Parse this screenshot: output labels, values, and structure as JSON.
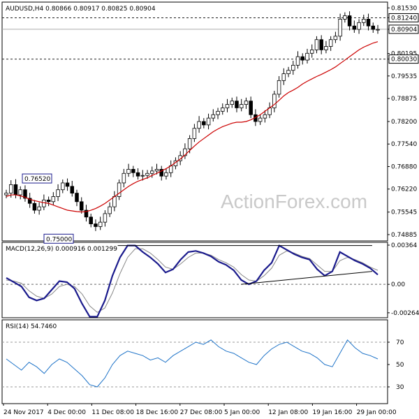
{
  "window": {
    "watermark": "ActionForex.com"
  },
  "chart_data": [
    {
      "type": "candlestick",
      "title": "AUDUSD,H4  0.80866 0.80917 0.80825 0.80904",
      "ylim": [
        0.747,
        0.817
      ],
      "yticks": [
        0.8153,
        0.8124,
        0.80904,
        0.80195,
        0.8003,
        0.79535,
        0.78875,
        0.782,
        0.7754,
        0.7688,
        0.7622,
        0.75545,
        0.74885
      ],
      "y_highlight_labels": [
        0.8124,
        0.80904,
        0.8003
      ],
      "annotations": [
        {
          "text": "0.76520",
          "value": 0.7652
        },
        {
          "text": "0.75000",
          "value": 0.75
        }
      ],
      "horizontal_lines": [
        {
          "value": 0.8124,
          "style": "dashed"
        },
        {
          "value": 0.80904,
          "style": "solid"
        },
        {
          "value": 0.8003,
          "style": "dashed"
        }
      ],
      "close_series": [
        0.761,
        0.7635,
        0.7605,
        0.762,
        0.7595,
        0.758,
        0.756,
        0.757,
        0.759,
        0.7585,
        0.76,
        0.762,
        0.764,
        0.763,
        0.761,
        0.7585,
        0.756,
        0.754,
        0.752,
        0.7512,
        0.7525,
        0.755,
        0.757,
        0.76,
        0.764,
        0.7668,
        0.768,
        0.767,
        0.766,
        0.7662,
        0.7668,
        0.7675,
        0.768,
        0.766,
        0.767,
        0.769,
        0.7705,
        0.772,
        0.774,
        0.777,
        0.78,
        0.782,
        0.781,
        0.783,
        0.784,
        0.785,
        0.786,
        0.787,
        0.788,
        0.786,
        0.787,
        0.788,
        0.784,
        0.782,
        0.783,
        0.784,
        0.786,
        0.79,
        0.794,
        0.796,
        0.797,
        0.7985,
        0.801,
        0.8,
        0.802,
        0.803,
        0.806,
        0.803,
        0.804,
        0.806,
        0.807,
        0.812,
        0.813,
        0.81,
        0.809,
        0.811,
        0.812,
        0.81,
        0.809,
        0.809
      ],
      "ma_series": [
        0.76,
        0.7605,
        0.7605,
        0.7602,
        0.7598,
        0.7592,
        0.7588,
        0.7585,
        0.7582,
        0.758,
        0.7575,
        0.757,
        0.7565,
        0.756,
        0.7558,
        0.7556,
        0.7555,
        0.7556,
        0.756,
        0.7565,
        0.7572,
        0.758,
        0.759,
        0.76,
        0.761,
        0.762,
        0.763,
        0.7638,
        0.7645,
        0.765,
        0.7655,
        0.7662,
        0.7668,
        0.7675,
        0.7682,
        0.769,
        0.77,
        0.771,
        0.7722,
        0.7735,
        0.7748,
        0.776,
        0.777,
        0.778,
        0.779,
        0.7798,
        0.7805,
        0.781,
        0.7815,
        0.7818,
        0.7818,
        0.782,
        0.7825,
        0.7832,
        0.784,
        0.785,
        0.786,
        0.787,
        0.7882,
        0.7895,
        0.7905,
        0.7912,
        0.792,
        0.793,
        0.7938,
        0.7945,
        0.7952,
        0.7958,
        0.7965,
        0.7972,
        0.798,
        0.799,
        0.8,
        0.801,
        0.802,
        0.803,
        0.8038,
        0.8044,
        0.805,
        0.8054
      ],
      "xticks": [
        "24 Nov 2017",
        "4 Dec 00:00",
        "11 Dec 08:00",
        "18 Dec 16:00",
        "27 Dec 08:00",
        "5 Jan 00:00",
        "12 Jan 08:00",
        "19 Jan 16:00",
        "29 Jan 00:00"
      ]
    },
    {
      "type": "line",
      "title": "MACD(12,26,9) 0.000916 0.001299",
      "ylim": [
        -0.0031,
        0.0039
      ],
      "yticks": [
        0.00364,
        0.0,
        -0.00264
      ],
      "ytick_labels": [
        "0.00364",
        "0.00",
        "-0.00264"
      ],
      "reference_line": 0.0,
      "series": [
        {
          "values": [
            0.0006,
            0.0002,
            -0.0002,
            -0.0012,
            -0.0015,
            -0.0013,
            -0.0005,
            0.0003,
            0.0002,
            -0.0004,
            -0.0018,
            -0.003,
            -0.003,
            -0.0015,
            0.0008,
            0.0025,
            0.0036,
            0.0036,
            0.003,
            0.0025,
            0.0019,
            0.0011,
            0.0014,
            0.0023,
            0.003,
            0.0031,
            0.0029,
            0.0026,
            0.0021,
            0.0018,
            0.0013,
            0.0004,
            0.0,
            0.0003,
            0.0013,
            0.002,
            0.0036,
            0.0032,
            0.0028,
            0.0025,
            0.0023,
            0.0014,
            0.0008,
            0.0012,
            0.003,
            0.0026,
            0.0022,
            0.0019,
            0.0015,
            0.0009
          ]
        },
        {
          "values": [
            0.0004,
            0.0003,
            0.0001,
            -0.0006,
            -0.0011,
            -0.0013,
            -0.0009,
            -0.0002,
            0.0,
            -0.0002,
            -0.0009,
            -0.002,
            -0.0026,
            -0.0022,
            -0.0008,
            0.001,
            0.0025,
            0.0033,
            0.0033,
            0.0029,
            0.0023,
            0.0016,
            0.0014,
            0.0019,
            0.0025,
            0.0029,
            0.0029,
            0.0027,
            0.0023,
            0.002,
            0.0016,
            0.0009,
            0.0004,
            0.0003,
            0.0008,
            0.0015,
            0.0027,
            0.0031,
            0.0029,
            0.0026,
            0.0024,
            0.0018,
            0.0012,
            0.0012,
            0.0022,
            0.0025,
            0.0023,
            0.002,
            0.0016,
            0.0013
          ]
        }
      ],
      "trend_lines": [
        {
          "from": [
            0.62,
            0.0
          ],
          "to": [
            0.96,
            0.0012
          ]
        },
        {
          "from": [
            0.3,
            0.0036
          ],
          "to": [
            0.96,
            0.0036
          ]
        }
      ]
    },
    {
      "type": "line",
      "title": "RSI(14) 54.7460",
      "ylim": [
        15,
        90
      ],
      "yticks": [
        70,
        50,
        30
      ],
      "reference_lines": [
        70,
        30
      ],
      "series": [
        {
          "values": [
            55,
            50,
            45,
            52,
            48,
            42,
            50,
            55,
            52,
            46,
            40,
            32,
            30,
            38,
            50,
            58,
            62,
            60,
            58,
            54,
            56,
            52,
            58,
            62,
            66,
            70,
            68,
            72,
            66,
            62,
            60,
            56,
            52,
            50,
            58,
            64,
            68,
            70,
            66,
            62,
            60,
            56,
            50,
            48,
            60,
            72,
            65,
            60,
            58,
            55
          ]
        }
      ]
    }
  ]
}
